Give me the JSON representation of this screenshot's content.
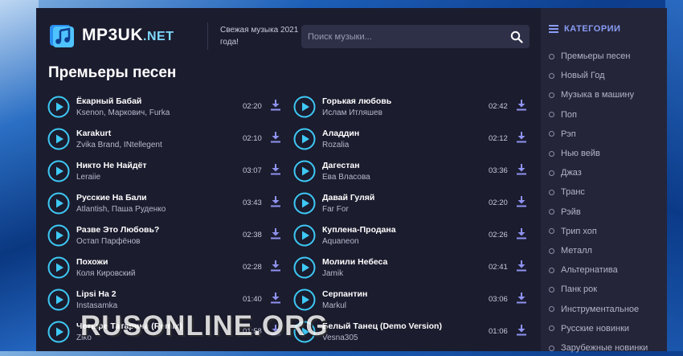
{
  "site": {
    "logo_text": "MP3UK",
    "logo_suffix": ".NET",
    "tagline": "Свежая музыка 2021 года!",
    "search_placeholder": "Поиск музыки..."
  },
  "section_title": "Премьеры песен",
  "tracks_left": [
    {
      "title": "Ёкарный Бабай",
      "artist": "Ksenon, Маркович, Furka",
      "time": "02:20"
    },
    {
      "title": "Karakurt",
      "artist": "Zvika Brand, INtellegent",
      "time": "02:10"
    },
    {
      "title": "Никто Не Найдёт",
      "artist": "Leraiie",
      "time": "03:07"
    },
    {
      "title": "Русские На Бали",
      "artist": "Atlantish, Паша Руденко",
      "time": "03:43"
    },
    {
      "title": "Разве Это Любовь?",
      "artist": "Остап Парфёнов",
      "time": "02:38"
    },
    {
      "title": "Похожи",
      "artist": "Коля Кировский",
      "time": "02:28"
    },
    {
      "title": "Lipsi Ha 2",
      "artist": "Instasamka",
      "time": "01:40"
    },
    {
      "title": "Четыре Татарина (Remix)",
      "artist": "Ziko",
      "time": "01:58"
    }
  ],
  "tracks_right": [
    {
      "title": "Горькая любовь",
      "artist": "Ислам Итляшев",
      "time": "02:42"
    },
    {
      "title": "Аладдин",
      "artist": "Rozalia",
      "time": "02:12"
    },
    {
      "title": "Дагестан",
      "artist": "Ева Власова",
      "time": "03:36"
    },
    {
      "title": "Давай Гуляй",
      "artist": "Far For",
      "time": "02:20"
    },
    {
      "title": "Куплена-Продана",
      "artist": "Aquaneon",
      "time": "02:26"
    },
    {
      "title": "Молили Небеса",
      "artist": "Jamik",
      "time": "02:41"
    },
    {
      "title": "Серпантин",
      "artist": "Markul",
      "time": "03:06"
    },
    {
      "title": "Белый Танец (Demo Version)",
      "artist": "Vesna305",
      "time": "01:06"
    }
  ],
  "sidebar": {
    "title": "КАТЕГОРИИ",
    "items": [
      "Премьеры песен",
      "Новый Год",
      "Музыка в машину",
      "Поп",
      "Рэп",
      "Нью вейв",
      "Джаз",
      "Транс",
      "Рэйв",
      "Трип хоп",
      "Металл",
      "Альтернатива",
      "Панк рок",
      "Инструментальное",
      "Русские новинки",
      "Зарубежные новинки"
    ]
  },
  "watermark": "RUSONLINE.ORG",
  "colors": {
    "accent": "#3ec9f5",
    "download": "#8f93f0",
    "category_title": "#8a9df5"
  }
}
